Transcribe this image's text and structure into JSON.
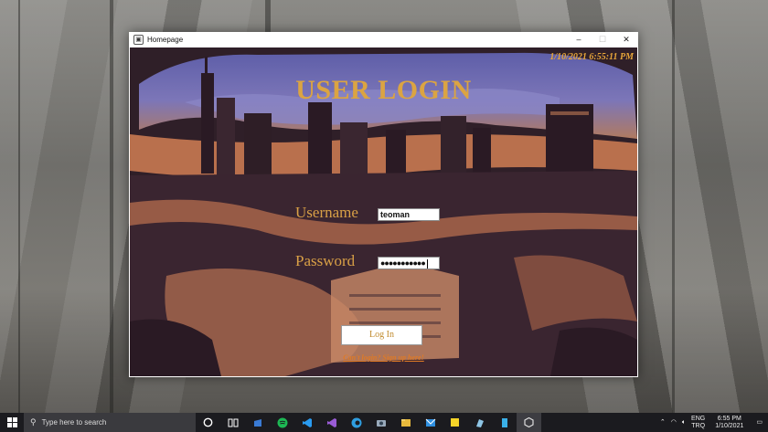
{
  "window": {
    "title": "Homepage",
    "minimize_glyph": "–",
    "maximize_glyph": "☐",
    "close_glyph": "✕"
  },
  "login": {
    "datetime": "1/10/2021 6:55:11 PM",
    "heading": "USER LOGIN",
    "username_label": "Username",
    "username_value": "teoman",
    "password_label": "Password",
    "password_value": "●●●●●●●●●●●",
    "login_button": "Log In",
    "signup_link": "Can't login? Sign up here!"
  },
  "colors": {
    "accent_gold": "#dba442",
    "link_orange": "#e07a24",
    "taskbar_bg": "#1b1b1f"
  },
  "taskbar": {
    "search_placeholder": "Type here to search",
    "pinned_icons": [
      "cortana-icon",
      "task-view-icon",
      "store-icon",
      "spotify-icon",
      "vscode-icon",
      "visual-studio-icon",
      "edge-icon",
      "camera-icon",
      "file-explorer-icon",
      "mail-icon",
      "sticky-notes-icon",
      "paint-icon",
      "app-icon",
      "unity-icon"
    ],
    "tray": {
      "language": "ENG",
      "region": "TRQ",
      "time": "6:55 PM",
      "date": "1/10/2021"
    }
  }
}
